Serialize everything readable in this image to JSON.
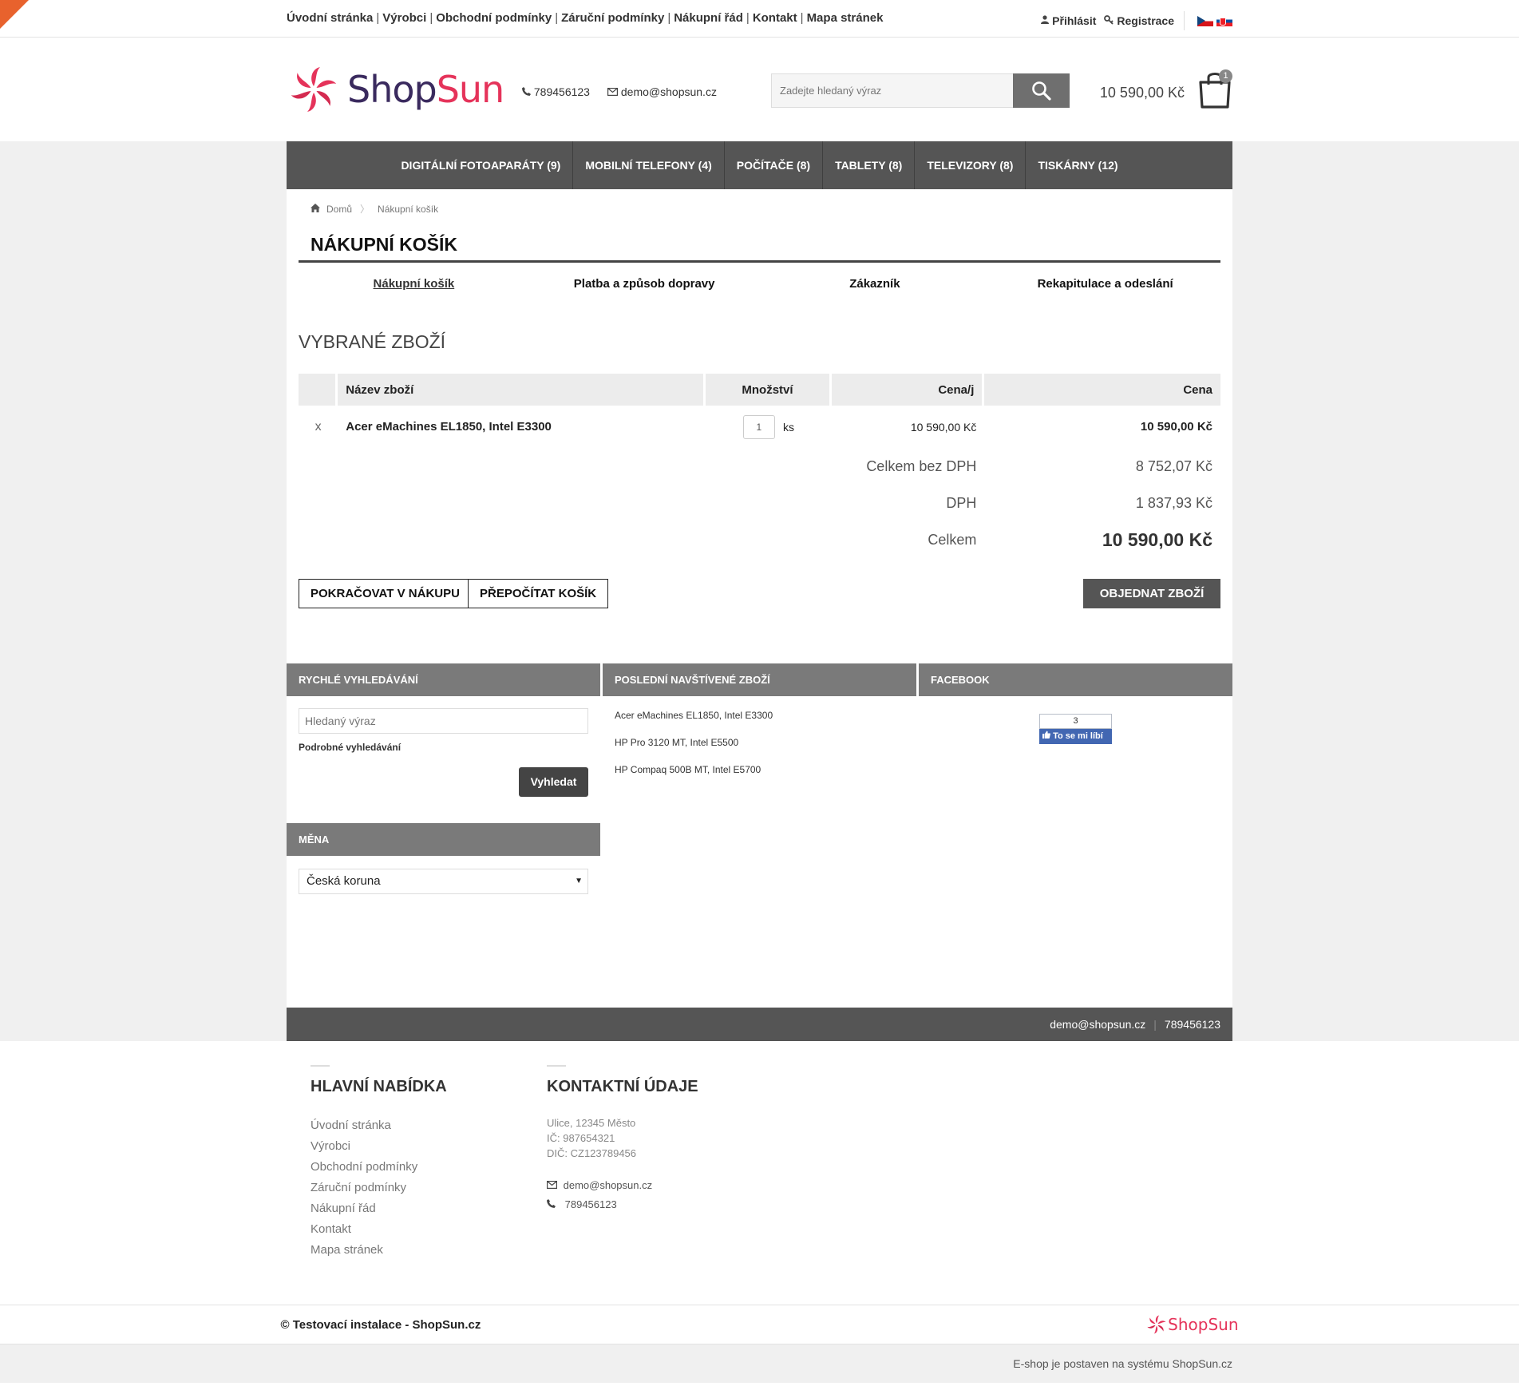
{
  "topbar": {
    "links": [
      "Úvodní stránka",
      "Výrobci",
      "Obchodní podmínky",
      "Záruční podmínky",
      "Nákupní řád",
      "Kontakt",
      "Mapa stránek"
    ],
    "login": "Přihlásit",
    "register": "Registrace"
  },
  "header": {
    "logo_shop": "Shop",
    "logo_sun": "Sun",
    "phone": "789456123",
    "email": "demo@shopsun.cz",
    "search_placeholder": "Zadejte hledaný výraz",
    "cart_total": "10 590,00 Kč",
    "cart_count": "1"
  },
  "nav": [
    "DIGITÁLNÍ FOTOAPARÁTY (9)",
    "MOBILNÍ TELEFONY (4)",
    "POČÍTAČE (8)",
    "TABLETY (8)",
    "TELEVIZORY (8)",
    "TISKÁRNY (12)"
  ],
  "breadcrumb": {
    "home": "Domů",
    "current": "Nákupní košík"
  },
  "page_title": "NÁKUPNÍ KOŠÍK",
  "steps": [
    "Nákupní košík",
    "Platba a způsob dopravy",
    "Zákazník",
    "Rekapitulace a odeslání"
  ],
  "section_title": "VYBRANÉ ZBOŽÍ",
  "table": {
    "headers": {
      "name": "Název zboží",
      "qty": "Množství",
      "unit": "Cena/j",
      "price": "Cena"
    },
    "row": {
      "remove": "x",
      "name": "Acer eMachines EL1850, Intel E3300",
      "qty": "1",
      "qty_unit": "ks",
      "unit_price": "10 590,00 Kč",
      "price": "10 590,00 Kč"
    },
    "summary": {
      "no_vat_label": "Celkem bez DPH",
      "no_vat_value": "8 752,07 Kč",
      "vat_label": "DPH",
      "vat_value": "1 837,93 Kč",
      "total_label": "Celkem",
      "total_value": "10 590,00 Kč"
    }
  },
  "buttons": {
    "continue": "POKRAČOVAT V NÁKUPU",
    "recalc": "PŘEPOČÍTAT KOŠÍK",
    "order": "OBJEDNAT ZBOŽÍ"
  },
  "boxes": {
    "quick_search": {
      "title": "RYCHLÉ VYHLEDÁVÁNÍ",
      "placeholder": "Hledaný výraz",
      "advanced": "Podrobné vyhledávání",
      "button": "Vyhledat"
    },
    "recent": {
      "title": "POSLEDNÍ NAVŠTÍVENÉ ZBOŽÍ",
      "items": [
        "Acer eMachines EL1850, Intel E3300",
        "HP Pro 3120 MT, Intel E5500",
        "HP Compaq 500B MT, Intel E5700"
      ]
    },
    "facebook": {
      "title": "FACEBOOK",
      "count": "3",
      "like": "To se mi líbí"
    },
    "currency": {
      "title": "MĚNA",
      "selected": "Česká koruna"
    }
  },
  "content_footer": {
    "email": "demo@shopsun.cz",
    "phone": "789456123"
  },
  "footer": {
    "main_title": "HLAVNÍ NABÍDKA",
    "main_links": [
      "Úvodní stránka",
      "Výrobci",
      "Obchodní podmínky",
      "Záruční podmínky",
      "Nákupní řád",
      "Kontakt",
      "Mapa stránek"
    ],
    "contact_title": "KONTAKTNÍ ÚDAJE",
    "address": "Ulice, 12345 Město",
    "ic": "IČ: 987654321",
    "dic": "DIČ: CZ123789456",
    "email": "demo@shopsun.cz",
    "phone": "789456123"
  },
  "copyright": "© Testovací instalace - ShopSun.cz",
  "small_logo": "ShopSun",
  "powered": "E-shop je postaven na systému ShopSun.cz",
  "colors": {
    "accent": "#e5335a",
    "logo_dark": "#3a2a5e",
    "nav_bg": "#555555",
    "corner": "#e8622d"
  }
}
